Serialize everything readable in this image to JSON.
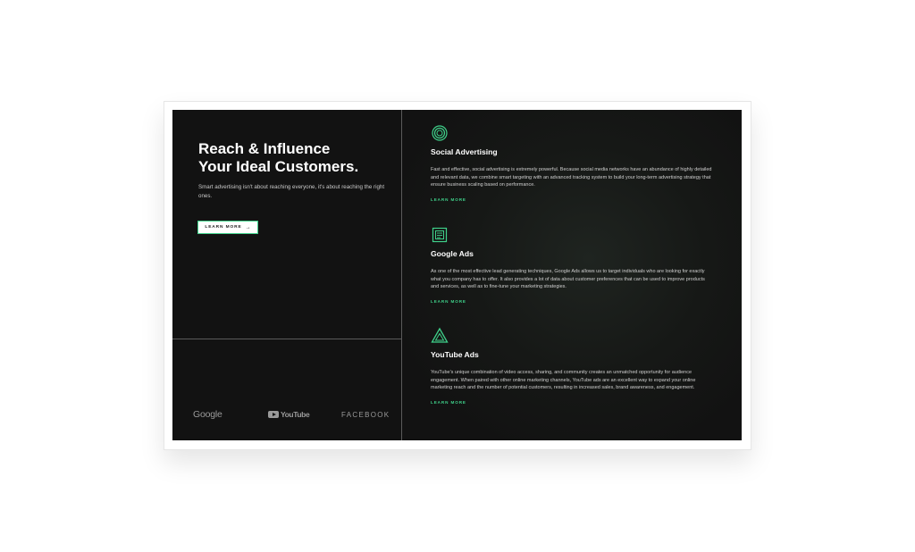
{
  "hero": {
    "title_line1": "Reach & Influence",
    "title_line2": "Your Ideal Customers.",
    "subtitle": "Smart advertising isn't about reaching everyone, it's about reaching the right ones.",
    "button_label": "LEARN MORE"
  },
  "logos": {
    "google": "Google",
    "youtube": "YouTube",
    "facebook": "FACEBOOK"
  },
  "services": [
    {
      "icon": "circle-rings-icon",
      "title": "Social Advertising",
      "description": "Fast and effective, social advertising is extremely powerful. Because social media networks have an abundance of highly detailed and relevant data, we combine smart targeting with an advanced tracking system to build your long-term advertising strategy that ensure business scaling based on performance.",
      "link_label": "LEARN MORE"
    },
    {
      "icon": "document-stack-icon",
      "title": "Google Ads",
      "description": "As one of the most effective lead generating techniques, Google Ads allows us to target individuals who are looking for exactly what you company has to offer. It also provides a lot of data about customer preferences that can be used to improve products and services, as well as to fine-tune your marketing strategies.",
      "link_label": "LEARN MORE"
    },
    {
      "icon": "triangle-play-icon",
      "title": "YouTube Ads",
      "description": "YouTube's unique combination of video access, sharing, and community creates an unmatched opportunity for audience engagement. When paired with other online marketing channels, YouTube ads are an excellent way to expand your online marketing reach and the number of potential customers, resulting in increased sales, brand awareness, and engagement.",
      "link_label": "LEARN MORE"
    }
  ],
  "colors": {
    "accent": "#3fd18a",
    "panel_bg": "#121212",
    "text_primary": "#ffffff",
    "text_secondary": "#cfcfcf"
  }
}
